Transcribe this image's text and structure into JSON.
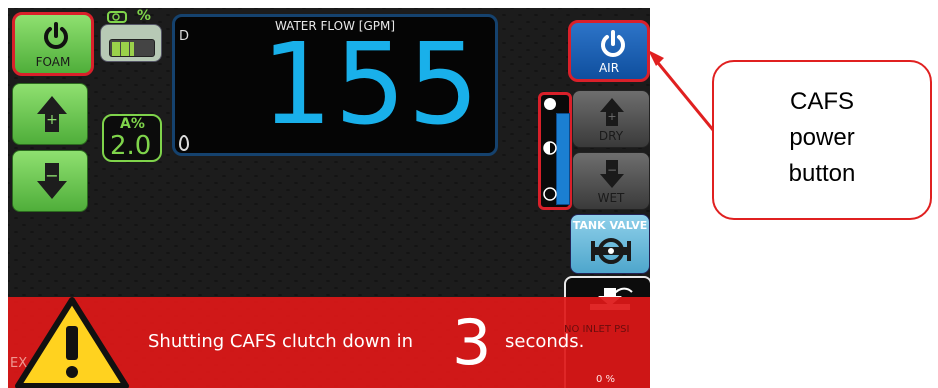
{
  "foam_button": {
    "label": "FOAM",
    "icon": "power-icon"
  },
  "tank_level": {
    "percent_label": "%",
    "icon": "foam-tank-icon",
    "level_fraction": 0.5
  },
  "additive": {
    "label": "A%",
    "value": "2.0"
  },
  "water_flow": {
    "title": "WATER FLOW [GPM]",
    "value": "155",
    "corner_label": "D"
  },
  "air_button": {
    "label": "AIR",
    "icon": "power-icon"
  },
  "mix": {
    "dry_label": "DRY",
    "wet_label": "WET"
  },
  "tank_valve": {
    "label": "TANK VALVE"
  },
  "alert": {
    "message": "Shutting CAFS clutch down in",
    "countdown": "3",
    "suffix": "seconds.",
    "background_label": "EX"
  },
  "inlet": {
    "status": "NO INLET PSI",
    "value": "0 %"
  },
  "callout": {
    "text_lines": [
      "CAFS",
      "power",
      "button"
    ]
  },
  "colors": {
    "accent_red": "#d9202a",
    "flow_blue": "#19b0ea",
    "button_green": "#5cbf44",
    "air_blue": "#1b5fb0"
  }
}
